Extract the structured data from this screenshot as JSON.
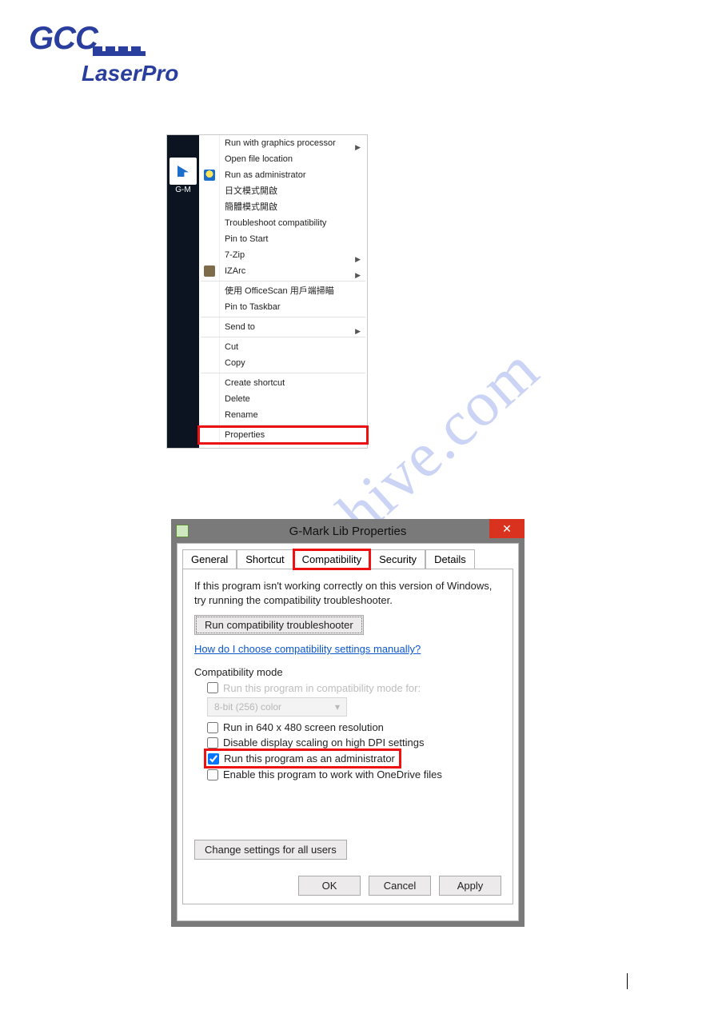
{
  "logo": {
    "brand": "GCC",
    "product": "LaserPro"
  },
  "watermark": "manualshive.com",
  "desktop_icon_label": "G-M",
  "context_menu": {
    "items": [
      {
        "label": "Run with graphics processor",
        "submenu": true
      },
      {
        "label": "Open file location"
      },
      {
        "label": "Run as administrator",
        "icon": "shield"
      },
      {
        "label": "日文模式開啟"
      },
      {
        "label": "簡體模式開啟"
      },
      {
        "label": "Troubleshoot compatibility"
      },
      {
        "label": "Pin to Start"
      },
      {
        "label": "7-Zip",
        "submenu": true
      },
      {
        "label": "IZArc",
        "submenu": true,
        "icon": "izarc"
      },
      {
        "sep": true
      },
      {
        "label": "使用 OfficeScan 用戶端掃瞄"
      },
      {
        "label": "Pin to Taskbar"
      },
      {
        "sep": true
      },
      {
        "label": "Send to",
        "submenu": true
      },
      {
        "sep": true
      },
      {
        "label": "Cut"
      },
      {
        "label": "Copy"
      },
      {
        "sep": true
      },
      {
        "label": "Create shortcut"
      },
      {
        "label": "Delete"
      },
      {
        "label": "Rename"
      },
      {
        "sep": true
      },
      {
        "label": "Properties",
        "highlight": true
      }
    ]
  },
  "properties_dialog": {
    "title": "G-Mark Lib Properties",
    "close": "✕",
    "tabs": [
      "General",
      "Shortcut",
      "Compatibility",
      "Security",
      "Details"
    ],
    "active_tab_index": 2,
    "intro1": "If this program isn't working correctly on this version of Windows,",
    "intro2": "try running the compatibility troubleshooter.",
    "run_troubleshooter_btn": "Run compatibility troubleshooter",
    "manual_link": "How do I choose compatibility settings manually?",
    "compat_mode_title": "Compatibility mode",
    "compat_mode_check": "Run this program in compatibility mode for:",
    "disabled_dropdown_text": "8-bit (256) color",
    "disabled_dropdown_caret": "▾",
    "check_640": "Run in 640 x 480 screen resolution",
    "check_dpi": "Disable display scaling on high DPI settings",
    "check_admin": "Run this program as an administrator",
    "check_onedrive": "Enable this program to work with OneDrive files",
    "change_all_users_btn": "Change settings for all users",
    "ok": "OK",
    "cancel": "Cancel",
    "apply": "Apply"
  }
}
